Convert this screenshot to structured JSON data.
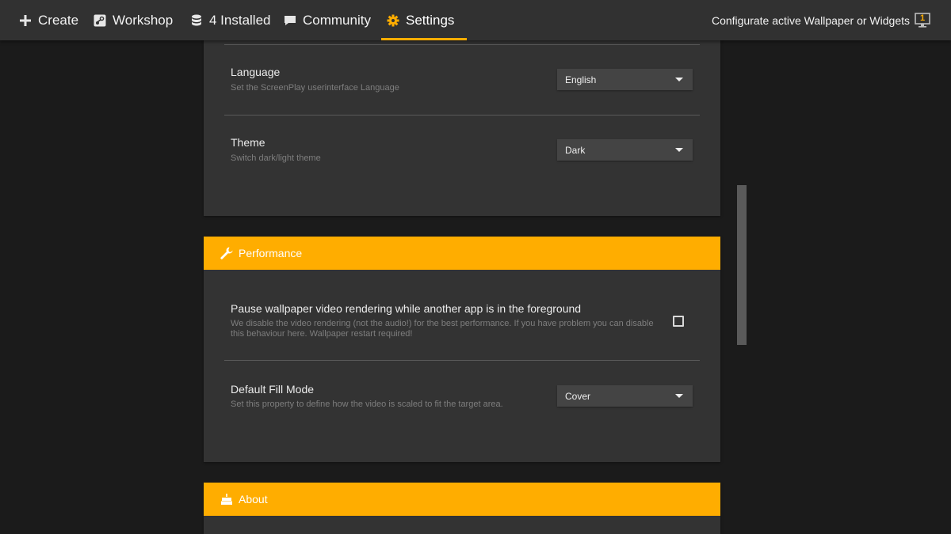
{
  "nav": {
    "create": "Create",
    "workshop": "Workshop",
    "installed": "4 Installed",
    "community": "Community",
    "settings": "Settings",
    "configure": "Configurate active Wallpaper or Widgets",
    "active_count": "1"
  },
  "general": {
    "language": {
      "title": "Language",
      "description": "Set the ScreenPlay userinterface Language",
      "value": "English"
    },
    "theme": {
      "title": "Theme",
      "description": "Switch dark/light theme",
      "value": "Dark"
    }
  },
  "performance": {
    "header": "Performance",
    "pause": {
      "title": "Pause wallpaper video rendering while another app is in the foreground",
      "description_line1": "We disable the video rendering (not the audio!) for the best performance. If you have problem you can disable",
      "description_line2": "this behaviour here. Wallpaper restart required!",
      "checked": false
    },
    "fill_mode": {
      "title": "Default Fill Mode",
      "description": "Set this property to define how the video is scaled to fit the target area.",
      "value": "Cover"
    }
  },
  "about": {
    "header": "About"
  },
  "colors": {
    "accent": "#ffad00",
    "navbar": "#313131",
    "card": "#333333",
    "background": "#1b1b1b"
  }
}
